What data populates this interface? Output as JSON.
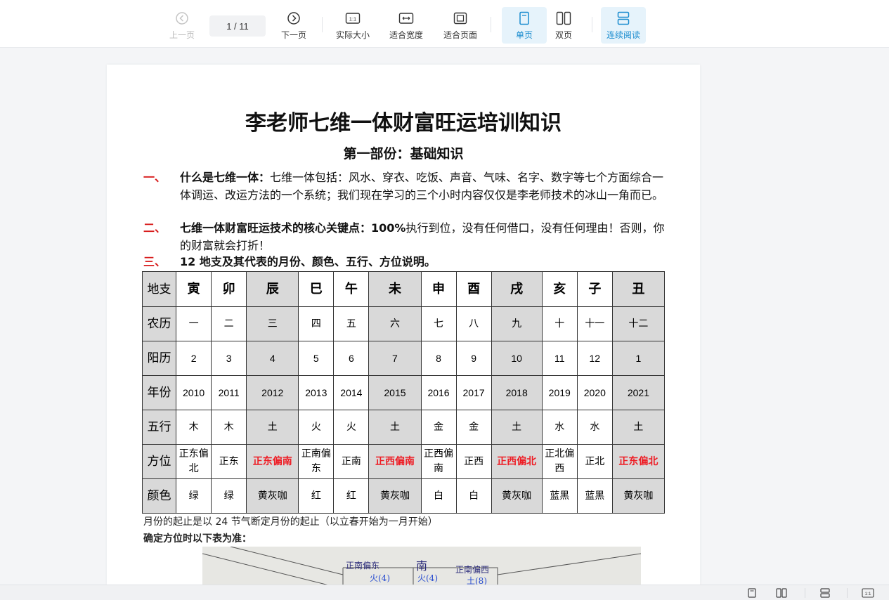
{
  "toolbar": {
    "prev_label": "上一页",
    "page_indicator": "1 / 11",
    "next_label": "下一页",
    "actual_size_label": "实际大小",
    "fit_width_label": "适合宽度",
    "fit_page_label": "适合页面",
    "single_page_label": "单页",
    "double_page_label": "双页",
    "continuous_label": "连续阅读",
    "actual_size_icon_text": "1:1"
  },
  "document": {
    "title": "李老师七维一体财富旺运培训知识",
    "subtitle": "第一部份：基础知识",
    "items": [
      {
        "num": "一、",
        "bold": "什么是七维一体：",
        "text": "七维一体包括：风水、穿衣、吃饭、声音、气味、名字、数字等七个方面综合一体调运、改运方法的一个系统；我们现在学习的三个小时内容仅仅是李老师技术的冰山一角而已。"
      },
      {
        "num": "二、",
        "bold": "七维一体财富旺运技术的核心关键点：",
        "bold2": "100%",
        "text": "执行到位，没有任何借口，没有任何理由！否则，你的财富就会打折！"
      },
      {
        "num": "三、",
        "bold": "12 地支及其代表的月份、颜色、五行、方位说明。",
        "text": ""
      }
    ],
    "table": {
      "row_headers": [
        "地支",
        "农历",
        "阳历",
        "年份",
        "五行",
        "方位",
        "颜色"
      ],
      "branches": [
        "寅",
        "卯",
        "辰",
        "巳",
        "午",
        "未",
        "申",
        "酉",
        "戌",
        "亥",
        "子",
        "丑"
      ],
      "lunar": [
        "一",
        "二",
        "三",
        "四",
        "五",
        "六",
        "七",
        "八",
        "九",
        "十",
        "十一",
        "十二"
      ],
      "solar": [
        "2",
        "3",
        "4",
        "5",
        "6",
        "7",
        "8",
        "9",
        "10",
        "11",
        "12",
        "1"
      ],
      "years": [
        "2010",
        "2011",
        "2012",
        "2013",
        "2014",
        "2015",
        "2016",
        "2017",
        "2018",
        "2019",
        "2020",
        "2021"
      ],
      "elements": [
        "木",
        "木",
        "土",
        "火",
        "火",
        "土",
        "金",
        "金",
        "土",
        "水",
        "水",
        "土"
      ],
      "directions": [
        "正东偏北",
        "正东",
        "正东偏南",
        "正南偏东",
        "正南",
        "正西偏南",
        "正西偏南",
        "正西",
        "正西偏北",
        "正北偏西",
        "正北",
        "正东偏北"
      ],
      "colors": [
        "绿",
        "绿",
        "黄灰咖",
        "红",
        "红",
        "黄灰咖",
        "白",
        "白",
        "黄灰咖",
        "蓝黑",
        "蓝黑",
        "黄灰咖"
      ],
      "highlight_color": "#ee1c24",
      "gray_color": "#d9d9d9"
    },
    "note1": "月份的起止是以 24 节气断定月份的起止（以立春开始为一月开始）",
    "note2": "确定方位时以下表为准：",
    "photo_labels": [
      "正南偏东",
      "南",
      "正南偏西",
      "火(4)",
      "火(4)",
      "土(8)"
    ]
  },
  "colors": {
    "accent": "#1a8ccf",
    "active_bg": "#e6f3fb",
    "red_number": "#d81e1e"
  }
}
